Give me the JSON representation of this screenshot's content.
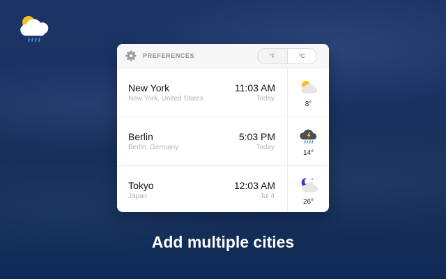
{
  "logo": {
    "icon": "sun-cloud-rain-icon"
  },
  "preferences": {
    "label": "PREFERENCES",
    "icon": "gear-icon"
  },
  "units": {
    "fahrenheit": "°F",
    "celsius": "°C",
    "selected": "°C"
  },
  "cities": [
    {
      "name": "New York",
      "region": "New York, United States",
      "time": "11:03 AM",
      "day": "Today",
      "temp": "8°",
      "icon": "partly-sunny-icon"
    },
    {
      "name": "Berlin",
      "region": "Berlin, Germany",
      "time": "5:03 PM",
      "day": "Today",
      "temp": "14°",
      "icon": "thunderstorm-rain-icon"
    },
    {
      "name": "Tokyo",
      "region": "Japan",
      "time": "12:03 AM",
      "day": "Jul 4",
      "temp": "26°",
      "icon": "partly-cloudy-night-icon"
    }
  ],
  "caption": "Add multiple cities",
  "colors": {
    "background": "#1a3262",
    "sun": "#f5c21b",
    "rain": "#3b86d6",
    "moon": "#2f3fc8"
  }
}
